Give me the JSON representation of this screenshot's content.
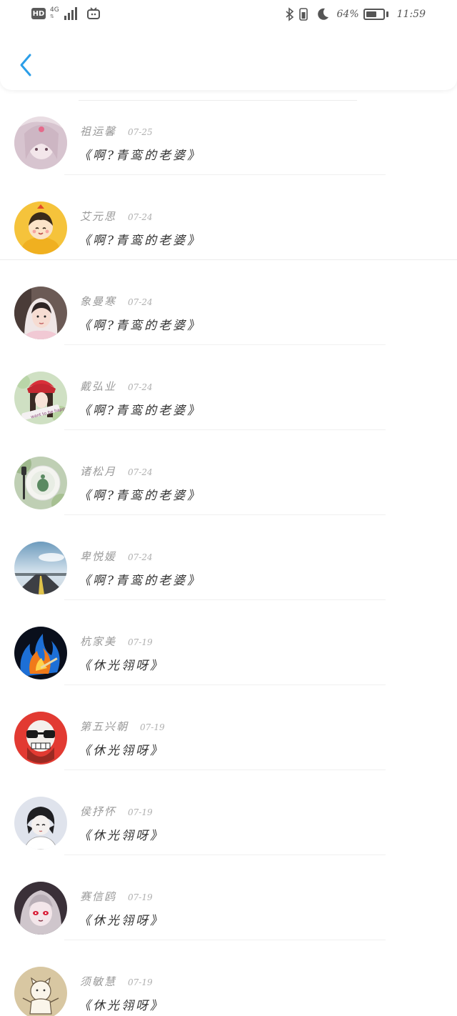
{
  "status_bar": {
    "hd": "HD",
    "network": "4G",
    "battery_text": "64%",
    "battery_level": 0.64,
    "time": "11:59",
    "icons": [
      "signal-icon",
      "tv-icon",
      "bluetooth-icon",
      "vibrate-icon",
      "moon-icon",
      "battery-icon"
    ]
  },
  "header": {
    "back_icon": "chevron-left-icon",
    "accent_color": "#2b9ee8"
  },
  "comments": [
    {
      "name": "祖运馨",
      "date": "07-25",
      "title": "《啊?青鸾的老婆》"
    },
    {
      "name": "艾元思",
      "date": "07-24",
      "title": "《啊?青鸾的老婆》"
    },
    {
      "name": "象曼寒",
      "date": "07-24",
      "title": "《啊?青鸾的老婆》"
    },
    {
      "name": "戴弘业",
      "date": "07-24",
      "title": "《啊?青鸾的老婆》"
    },
    {
      "name": "诸松月",
      "date": "07-24",
      "title": "《啊?青鸾的老婆》"
    },
    {
      "name": "卑悦媛",
      "date": "07-24",
      "title": "《啊?青鸾的老婆》"
    },
    {
      "name": "杭家美",
      "date": "07-19",
      "title": "《休光翎呀》"
    },
    {
      "name": "第五兴朝",
      "date": "07-19",
      "title": "《休光翎呀》"
    },
    {
      "name": "侯抒怀",
      "date": "07-19",
      "title": "《休光翎呀》"
    },
    {
      "name": "赛信鸥",
      "date": "07-19",
      "title": "《休光翎呀》"
    },
    {
      "name": "须敏慧",
      "date": "07-19",
      "title": "《休光翎呀》"
    }
  ]
}
